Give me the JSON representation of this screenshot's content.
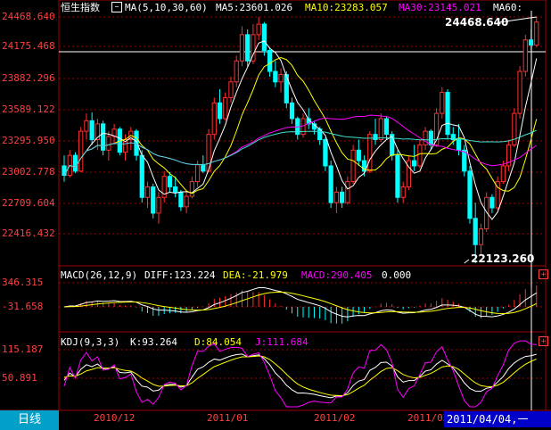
{
  "header": {
    "index_name": "恒生指数",
    "ma_label": "MA(5,10,30,60)",
    "ma5": "MA5:23601.026",
    "ma10": "MA10:23283.057",
    "ma30": "MA30:23145.021",
    "ma60": "MA60:"
  },
  "macd_header": {
    "label": "MACD(26,12,9)",
    "diff": "DIFF:123.224",
    "dea": "DEA:-21.979",
    "macd": "MACD:290.405",
    "extra": "0.000"
  },
  "kdj_header": {
    "label": "KDJ(9,3,3)",
    "k": "K:93.264",
    "d": "D:84.054",
    "j": "J:111.684"
  },
  "price_axis": [
    "24468.640",
    "24175.468",
    "23882.296",
    "23589.122",
    "23295.950",
    "23002.778",
    "22709.604",
    "22416.432"
  ],
  "macd_axis": [
    "346.315",
    "-31.658"
  ],
  "kdj_axis": [
    "115.187",
    "50.891"
  ],
  "x_axis": [
    "2010/12",
    "2011/01",
    "2011/02",
    "2011/03"
  ],
  "callouts": {
    "high": "24468.640",
    "low": "22123.260"
  },
  "footer": {
    "tab": "日线",
    "cursor_date": "2011/04/04,一"
  },
  "buttons": {
    "expand": "+"
  },
  "colors": {
    "up": "#ff3030",
    "down": "#00ffff",
    "ma5": "#ffffff",
    "ma10": "#ffff00",
    "ma30": "#ff00ff",
    "ma60": "#00ff00",
    "grid": "#a00000"
  },
  "chart_data": {
    "type": "candlestick",
    "title": "恒生指数",
    "price_range": [
      22123.26,
      24468.64
    ],
    "candles": [
      {
        "o": 23050,
        "h": 23150,
        "l": 22900,
        "c": 22960
      },
      {
        "o": 22960,
        "h": 23200,
        "l": 22940,
        "c": 23150
      },
      {
        "o": 23150,
        "h": 23180,
        "l": 22980,
        "c": 23000
      },
      {
        "o": 23000,
        "h": 23420,
        "l": 22990,
        "c": 23380
      },
      {
        "o": 23380,
        "h": 23550,
        "l": 23300,
        "c": 23480
      },
      {
        "o": 23480,
        "h": 23560,
        "l": 23250,
        "c": 23300
      },
      {
        "o": 23300,
        "h": 23500,
        "l": 23200,
        "c": 23450
      },
      {
        "o": 23450,
        "h": 23480,
        "l": 23150,
        "c": 23200
      },
      {
        "o": 23200,
        "h": 23380,
        "l": 23100,
        "c": 23330
      },
      {
        "o": 23330,
        "h": 23450,
        "l": 23250,
        "c": 23400
      },
      {
        "o": 23400,
        "h": 23420,
        "l": 23150,
        "c": 23180
      },
      {
        "o": 23180,
        "h": 23350,
        "l": 23100,
        "c": 23300
      },
      {
        "o": 23300,
        "h": 23420,
        "l": 23200,
        "c": 23380
      },
      {
        "o": 23380,
        "h": 23400,
        "l": 23100,
        "c": 23150
      },
      {
        "o": 23150,
        "h": 23200,
        "l": 22700,
        "c": 22750
      },
      {
        "o": 22750,
        "h": 22900,
        "l": 22650,
        "c": 22850
      },
      {
        "o": 22850,
        "h": 22880,
        "l": 22550,
        "c": 22600
      },
      {
        "o": 22600,
        "h": 22800,
        "l": 22500,
        "c": 22750
      },
      {
        "o": 22750,
        "h": 23000,
        "l": 22700,
        "c": 22950
      },
      {
        "o": 22950,
        "h": 22990,
        "l": 22800,
        "c": 22850
      },
      {
        "o": 22850,
        "h": 22950,
        "l": 22750,
        "c": 22800
      },
      {
        "o": 22800,
        "h": 22820,
        "l": 22620,
        "c": 22660
      },
      {
        "o": 22660,
        "h": 22800,
        "l": 22600,
        "c": 22760
      },
      {
        "o": 22760,
        "h": 22950,
        "l": 22740,
        "c": 22900
      },
      {
        "o": 22900,
        "h": 23100,
        "l": 22850,
        "c": 23060
      },
      {
        "o": 23060,
        "h": 23150,
        "l": 22980,
        "c": 23000
      },
      {
        "o": 23000,
        "h": 23400,
        "l": 22990,
        "c": 23350
      },
      {
        "o": 23350,
        "h": 23700,
        "l": 23300,
        "c": 23650
      },
      {
        "o": 23650,
        "h": 23780,
        "l": 23450,
        "c": 23500
      },
      {
        "o": 23500,
        "h": 23750,
        "l": 23480,
        "c": 23700
      },
      {
        "o": 23700,
        "h": 23900,
        "l": 23650,
        "c": 23850
      },
      {
        "o": 23850,
        "h": 24100,
        "l": 23800,
        "c": 24050
      },
      {
        "o": 24050,
        "h": 24380,
        "l": 24000,
        "c": 24300
      },
      {
        "o": 24300,
        "h": 24350,
        "l": 24000,
        "c": 24050
      },
      {
        "o": 24050,
        "h": 24400,
        "l": 24020,
        "c": 24300
      },
      {
        "o": 24300,
        "h": 24470,
        "l": 24250,
        "c": 24400
      },
      {
        "o": 24400,
        "h": 24420,
        "l": 24100,
        "c": 24150
      },
      {
        "o": 24150,
        "h": 24180,
        "l": 23900,
        "c": 23950
      },
      {
        "o": 23950,
        "h": 24050,
        "l": 23800,
        "c": 23850
      },
      {
        "o": 23850,
        "h": 23980,
        "l": 23750,
        "c": 23920
      },
      {
        "o": 23920,
        "h": 23950,
        "l": 23600,
        "c": 23650
      },
      {
        "o": 23650,
        "h": 23700,
        "l": 23450,
        "c": 23500
      },
      {
        "o": 23500,
        "h": 23520,
        "l": 23300,
        "c": 23350
      },
      {
        "o": 23350,
        "h": 23550,
        "l": 23320,
        "c": 23500
      },
      {
        "o": 23500,
        "h": 23600,
        "l": 23400,
        "c": 23450
      },
      {
        "o": 23450,
        "h": 23480,
        "l": 23350,
        "c": 23400
      },
      {
        "o": 23400,
        "h": 23420,
        "l": 23250,
        "c": 23300
      },
      {
        "o": 23300,
        "h": 23320,
        "l": 23000,
        "c": 23050
      },
      {
        "o": 23050,
        "h": 23100,
        "l": 22650,
        "c": 22700
      },
      {
        "o": 22700,
        "h": 22850,
        "l": 22600,
        "c": 22800
      },
      {
        "o": 22800,
        "h": 22850,
        "l": 22650,
        "c": 22700
      },
      {
        "o": 22700,
        "h": 22950,
        "l": 22680,
        "c": 22900
      },
      {
        "o": 22900,
        "h": 23250,
        "l": 22880,
        "c": 23200
      },
      {
        "o": 23200,
        "h": 23300,
        "l": 23050,
        "c": 23100
      },
      {
        "o": 23100,
        "h": 23150,
        "l": 22950,
        "c": 23000
      },
      {
        "o": 23000,
        "h": 23380,
        "l": 22980,
        "c": 23350
      },
      {
        "o": 23350,
        "h": 23500,
        "l": 23250,
        "c": 23300
      },
      {
        "o": 23300,
        "h": 23550,
        "l": 23280,
        "c": 23500
      },
      {
        "o": 23500,
        "h": 23520,
        "l": 23300,
        "c": 23350
      },
      {
        "o": 23350,
        "h": 23380,
        "l": 23100,
        "c": 23150
      },
      {
        "o": 23150,
        "h": 23200,
        "l": 22700,
        "c": 22750
      },
      {
        "o": 22750,
        "h": 22900,
        "l": 22700,
        "c": 22850
      },
      {
        "o": 22850,
        "h": 23150,
        "l": 22820,
        "c": 23100
      },
      {
        "o": 23100,
        "h": 23250,
        "l": 23000,
        "c": 23050
      },
      {
        "o": 23050,
        "h": 23300,
        "l": 23030,
        "c": 23250
      },
      {
        "o": 23250,
        "h": 23420,
        "l": 23200,
        "c": 23380
      },
      {
        "o": 23380,
        "h": 23400,
        "l": 23200,
        "c": 23250
      },
      {
        "o": 23250,
        "h": 23600,
        "l": 23230,
        "c": 23550
      },
      {
        "o": 23550,
        "h": 23800,
        "l": 23500,
        "c": 23750
      },
      {
        "o": 23750,
        "h": 23780,
        "l": 23300,
        "c": 23350
      },
      {
        "o": 23350,
        "h": 23420,
        "l": 23250,
        "c": 23300
      },
      {
        "o": 23300,
        "h": 23450,
        "l": 23150,
        "c": 23200
      },
      {
        "o": 23200,
        "h": 23250,
        "l": 22950,
        "c": 23000
      },
      {
        "o": 23000,
        "h": 23050,
        "l": 22500,
        "c": 22550
      },
      {
        "o": 22550,
        "h": 22700,
        "l": 22123,
        "c": 22300
      },
      {
        "o": 22300,
        "h": 22500,
        "l": 22200,
        "c": 22450
      },
      {
        "o": 22450,
        "h": 22800,
        "l": 22420,
        "c": 22750
      },
      {
        "o": 22750,
        "h": 22780,
        "l": 22600,
        "c": 22650
      },
      {
        "o": 22650,
        "h": 22950,
        "l": 22630,
        "c": 22900
      },
      {
        "o": 22900,
        "h": 23100,
        "l": 22880,
        "c": 23050
      },
      {
        "o": 23050,
        "h": 23300,
        "l": 23000,
        "c": 23250
      },
      {
        "o": 23250,
        "h": 23600,
        "l": 23230,
        "c": 23550
      },
      {
        "o": 23550,
        "h": 24000,
        "l": 23500,
        "c": 23950
      },
      {
        "o": 23950,
        "h": 24300,
        "l": 23900,
        "c": 24250
      },
      {
        "o": 24250,
        "h": 24350,
        "l": 24150,
        "c": 24200
      },
      {
        "o": 24200,
        "h": 24468,
        "l": 24180,
        "c": 24420
      }
    ]
  }
}
